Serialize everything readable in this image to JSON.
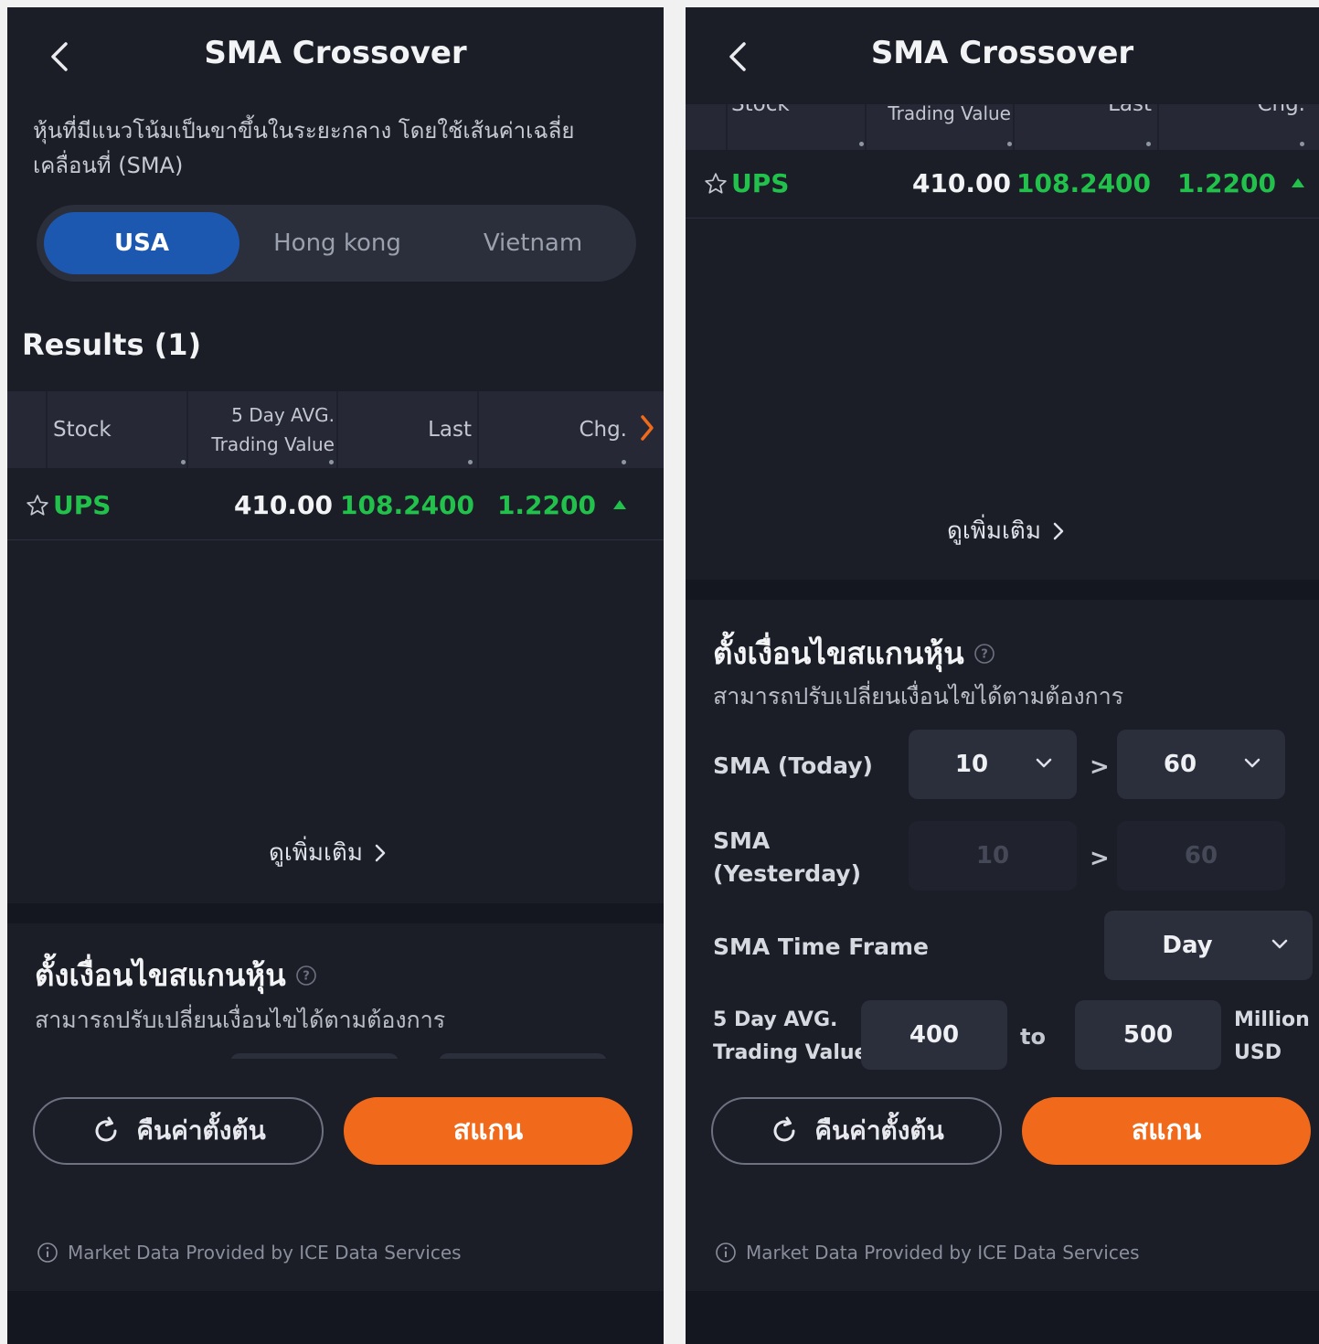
{
  "header": {
    "title": "SMA Crossover"
  },
  "description": "หุ้นที่มีแนวโน้มเป็นขาขึ้นในระยะกลาง โดยใช้เส้นค่าเฉลี่ยเคลื่อนที่ (SMA)",
  "markets": {
    "selected": "USA",
    "options": [
      "USA",
      "Hong kong",
      "Vietnam"
    ]
  },
  "results": {
    "title": "Results (1)",
    "columns": {
      "stock": "Stock",
      "avg_line1": "5 Day AVG.",
      "avg_line2": "Trading Value",
      "last": "Last",
      "chg": "Chg."
    },
    "rows": [
      {
        "symbol": "UPS",
        "avg_value": "410.00",
        "last": "108.2400",
        "chg": "1.2200",
        "direction": "up"
      }
    ],
    "see_more": "ดูเพิ่มเติม"
  },
  "conditions": {
    "title": "ตั้งเงื่อนไขสแกนหุ้น",
    "subtitle": "สามารถปรับเปลี่ยนเงื่อนไขได้ตามต้องการ",
    "sma_today": {
      "label": "SMA (Today)",
      "short": "10",
      "long": "60"
    },
    "sma_yesterday": {
      "label_line1": "SMA",
      "label_line2": "(Yesterday)",
      "short": "10",
      "long": "60"
    },
    "time_frame": {
      "label": "SMA Time Frame",
      "value": "Day"
    },
    "trading_value": {
      "label_line1": "5 Day AVG.",
      "label_line2": "Trading Value",
      "min": "400",
      "to": "to",
      "max": "500",
      "unit_line1": "Million",
      "unit_line2": "USD"
    },
    "gt": ">"
  },
  "actions": {
    "reset": "คืนค่าตั้งต้น",
    "scan": "สแกน"
  },
  "footnote": "Market Data Provided by ICE Data Services",
  "colors": {
    "background": "#1b1d27",
    "accent_blue": "#1c58b0",
    "accent_orange": "#f16a1c",
    "positive_green": "#22c14c"
  }
}
